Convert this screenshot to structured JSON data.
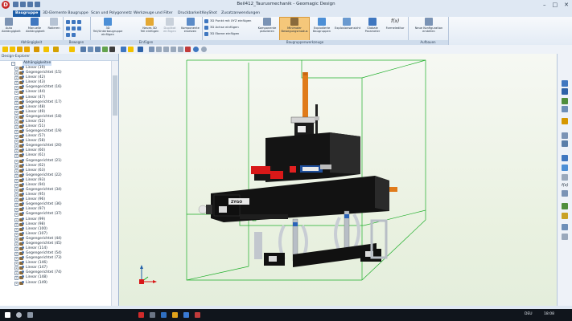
{
  "window": {
    "title": "Beil412_Taurusmechanik - Geomagic Design",
    "logo_letter": "D"
  },
  "tabs": [
    "Baugruppe",
    "3D-Elemente Baugruppe",
    "Scan und Polygonnetz",
    "Werkzeuge und Filter",
    "Druckbarkeit",
    "KeyShot",
    "Zusatzanwendungen"
  ],
  "ribbon": {
    "groups": [
      "Abhängigkeit",
      "Bewegen",
      "Einfügen",
      "Baugruppenwerkzeuge",
      "Aufbauen"
    ],
    "buttons": {
      "auto": "Auto Abhängigkeit",
      "manual": "Manuelle Abhängigkeit",
      "rotate": "Rotieren",
      "insert_sub": "3D Teil/Unterbaugruppe einfügen",
      "new_part": "Neues 3D Teil einfügen",
      "duplicate": "Duplikat einfügen",
      "replace": "Komponente ersetzen",
      "point": "3D Punkt mit XYZ einfügen",
      "axis": "3D Achse einfügen",
      "plane": "3D Ebene einfügen",
      "place": "Komponente platzieren",
      "minimal": "Minimaler Bewegungsmodus",
      "explode_groups": "Explodierte Baugruppen",
      "explode_view": "Explosionsansicht",
      "global_params": "Globale Parameter",
      "formula": "Formeleditor",
      "new_config": "Neue Konfiguration erstellen"
    }
  },
  "explorer": {
    "title": "Design-Explorer",
    "root": "Abhängigkeiten",
    "items": [
      "Linear (19)",
      "Gegengerichtet (15)",
      "Linear (42)",
      "Linear (43)",
      "Gegengerichtet (16)",
      "Linear (44)",
      "Linear (47)",
      "Gegengerichtet (17)",
      "Linear (48)",
      "Linear (49)",
      "Gegengerichtet (18)",
      "Linear (52)",
      "Linear (51)",
      "Gegengerichtet (19)",
      "Linear (57)",
      "Linear (58)",
      "Gegengerichtet (20)",
      "Linear (60)",
      "Linear (61)",
      "Gegengerichtet (21)",
      "Linear (62)",
      "Linear (63)",
      "Gegengerichtet (22)",
      "Linear (93)",
      "Linear (94)",
      "Gegengerichtet (34)",
      "Linear (95)",
      "Linear (96)",
      "Gegengerichtet (36)",
      "Linear (97)",
      "Gegengerichtet (37)",
      "Linear (99)",
      "Linear (98)",
      "Linear (100)",
      "Linear (107)",
      "Gegengerichtet (44)",
      "Gegengerichtet (45)",
      "Linear (114)",
      "Gegengerichtet (54)",
      "Gegengerichtet (73)",
      "Linear (146)",
      "Linear (147)",
      "Gegengerichtet (74)",
      "Linear (148)",
      "Linear (149)"
    ]
  },
  "model": {
    "label": "ZYGO"
  },
  "taskbar": {
    "time": "18:08",
    "lang": "DEU"
  },
  "colors": {
    "accent": "#1e5ea8",
    "model_orange": "#e07b1a",
    "model_red": "#d81818",
    "bbox_green": "#1fae2a",
    "bg": "#eef3e7"
  }
}
